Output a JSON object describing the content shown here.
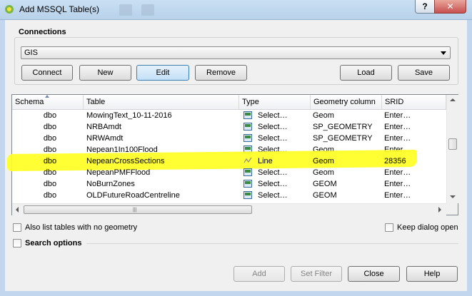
{
  "window": {
    "title": "Add MSSQL Table(s)",
    "help_label": "?",
    "close_label": "✕"
  },
  "connections": {
    "label": "Connections",
    "selected": "GIS",
    "buttons": {
      "connect": "Connect",
      "new": "New",
      "edit": "Edit",
      "remove": "Remove",
      "load": "Load",
      "save": "Save"
    }
  },
  "table": {
    "columns": [
      "Schema",
      "Table",
      "Type",
      "Geometry column",
      "SRID"
    ],
    "rows": [
      {
        "schema": "dbo",
        "table": "MowingText_10-11-2016",
        "type": "Select…",
        "geom": "Geom",
        "srid": "Enter…"
      },
      {
        "schema": "dbo",
        "table": "NRBAmdt",
        "type": "Select…",
        "geom": "SP_GEOMETRY",
        "srid": "Enter…"
      },
      {
        "schema": "dbo",
        "table": "NRWAmdt",
        "type": "Select…",
        "geom": "SP_GEOMETRY",
        "srid": "Enter…"
      },
      {
        "schema": "dbo",
        "table": "Nepean1In100Flood",
        "type": "Select…",
        "geom": "Geom",
        "srid": "Enter…"
      },
      {
        "schema": "dbo",
        "table": "NepeanCrossSections",
        "type": "Line",
        "geom": "Geom",
        "srid": "28356"
      },
      {
        "schema": "dbo",
        "table": "NepeanPMFFlood",
        "type": "Select…",
        "geom": "Geom",
        "srid": "Enter…"
      },
      {
        "schema": "dbo",
        "table": "NoBurnZones",
        "type": "Select…",
        "geom": "GEOM",
        "srid": "Enter…"
      },
      {
        "schema": "dbo",
        "table": "OLDFutureRoadCentreline",
        "type": "Select…",
        "geom": "GEOM",
        "srid": "Enter…"
      }
    ]
  },
  "options": {
    "no_geometry": "Also list tables with no geometry",
    "keep_open": "Keep dialog open",
    "search": "Search options"
  },
  "footer": {
    "add": "Add",
    "set_filter": "Set Filter",
    "close": "Close",
    "help": "Help"
  },
  "colors": {
    "highlight": "#ffff22",
    "titlebar": "#c9dff3"
  },
  "icons": {
    "type_select": "table-type-icon",
    "type_line": "line-type-icon"
  }
}
